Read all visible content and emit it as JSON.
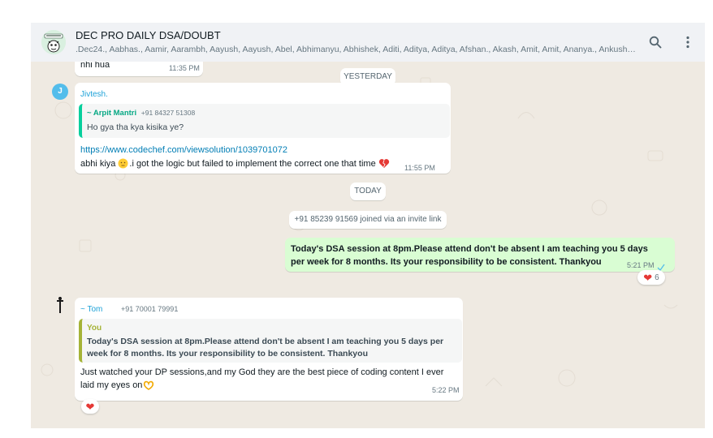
{
  "header": {
    "title": "DEC PRO DAILY DSA/DOUBT",
    "members": ".Dec24., Aabhas., Aamir, Aarambh, Aayush, Aayush, Abel, Abhimanyu, Abhishek, Aditi, Aditya, Aditya, Afshan., Akash, Amit, Amit, Ananya., Ankush., ...",
    "avatar_icon": "group-avatar-icon",
    "search_icon": "search-icon",
    "menu_icon": "more-vertical-icon"
  },
  "colors": {
    "header_bg": "#f0f2f5",
    "chat_bg": "#efeae2",
    "outgoing_bubble": "#d9fdd3",
    "link": "#027eb5",
    "sender_blue": "#1fa2d8",
    "quote_green": "#06cf9c",
    "heart": "#e53935"
  },
  "messages": {
    "prev": {
      "text": "nhi hua",
      "time": "11:35 PM"
    },
    "date_yesterday": "YESTERDAY",
    "jivtesh": {
      "avatar_letter": "J",
      "sender": "Jivtesh.",
      "quote_author": "~ Arpit Mantri",
      "quote_phone": "+91 84327 51308",
      "quote_text": "Ho gya tha kya kisika ye?",
      "link": "https://www.codechef.com/viewsolution/1039701072",
      "body_a": "abhi kiya",
      "body_b": ".i got the logic but failed to implement the correct one that time",
      "time": "11:55 PM"
    },
    "date_today": "TODAY",
    "system": "+91 85239 91569 joined via an invite link",
    "outgoing": {
      "line1": "Today's DSA session at 8pm.Please attend don't be absent I am teaching you 5 days",
      "line2": "per week for 8 months. Its your responsibility to be consistent. Thankyou",
      "time": "5:21 PM",
      "reaction_count": "6"
    },
    "tom": {
      "sender": "~ Tom",
      "phone": "+91 70001 79991",
      "quote_author": "You",
      "quote_line1": "Today's DSA session at 8pm.Please attend don't be absent I am teaching you 5 days per",
      "quote_line2": "week for 8 months. Its your responsibility to be consistent. Thankyou",
      "body_line1": "Just watched your DP sessions,and my God they are the best piece of coding content I ever",
      "body_line2": "laid my eyes on",
      "time": "5:22 PM"
    }
  }
}
